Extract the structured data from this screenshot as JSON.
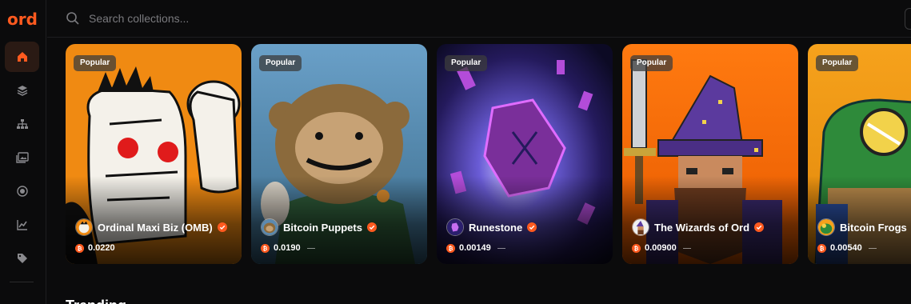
{
  "app": {
    "logo_text": "ord"
  },
  "sidebar": {
    "items": [
      {
        "name": "home",
        "icon": "home-icon",
        "active": true
      },
      {
        "name": "layers",
        "icon": "layers-icon",
        "active": false
      },
      {
        "name": "hierarchy",
        "icon": "sitemap-icon",
        "active": false
      },
      {
        "name": "images",
        "icon": "images-icon",
        "active": false
      },
      {
        "name": "circle",
        "icon": "target-icon",
        "active": false
      },
      {
        "name": "chart",
        "icon": "chart-line-icon",
        "active": false
      },
      {
        "name": "tag",
        "icon": "tag-icon",
        "active": false
      }
    ]
  },
  "search": {
    "placeholder": "Search collections..."
  },
  "colors": {
    "accent": "#ff5a1f",
    "background": "#0b0b0c"
  },
  "collections": [
    {
      "badge": "Popular",
      "name": "Ordinal Maxi Biz (OMB)",
      "price": "0.0220",
      "verified": true
    },
    {
      "badge": "Popular",
      "name": "Bitcoin Puppets",
      "price": "0.0190",
      "verified": true
    },
    {
      "badge": "Popular",
      "name": "Runestone",
      "price": "0.00149",
      "verified": true
    },
    {
      "badge": "Popular",
      "name": "The Wizards of Ord",
      "price": "0.00900",
      "verified": true
    },
    {
      "badge": "Popular",
      "name": "Bitcoin Frogs",
      "price": "0.00540",
      "verified": true
    }
  ],
  "next_section": {
    "heading": "Trending"
  }
}
